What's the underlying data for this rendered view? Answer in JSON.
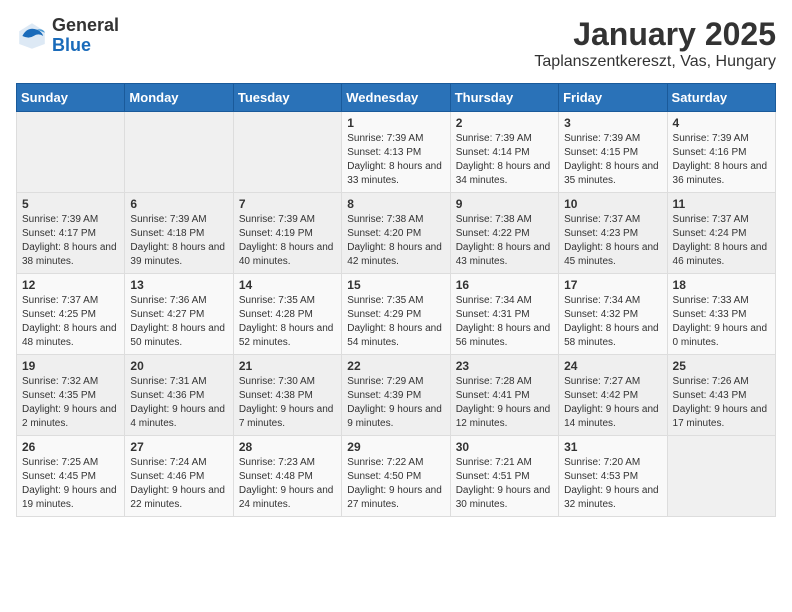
{
  "header": {
    "logo": {
      "general": "General",
      "blue": "Blue"
    },
    "title": "January 2025",
    "subtitle": "Taplanszentkereszt, Vas, Hungary"
  },
  "calendar": {
    "weekdays": [
      "Sunday",
      "Monday",
      "Tuesday",
      "Wednesday",
      "Thursday",
      "Friday",
      "Saturday"
    ],
    "weeks": [
      [
        {
          "day": "",
          "info": ""
        },
        {
          "day": "",
          "info": ""
        },
        {
          "day": "",
          "info": ""
        },
        {
          "day": "1",
          "info": "Sunrise: 7:39 AM\nSunset: 4:13 PM\nDaylight: 8 hours and 33 minutes."
        },
        {
          "day": "2",
          "info": "Sunrise: 7:39 AM\nSunset: 4:14 PM\nDaylight: 8 hours and 34 minutes."
        },
        {
          "day": "3",
          "info": "Sunrise: 7:39 AM\nSunset: 4:15 PM\nDaylight: 8 hours and 35 minutes."
        },
        {
          "day": "4",
          "info": "Sunrise: 7:39 AM\nSunset: 4:16 PM\nDaylight: 8 hours and 36 minutes."
        }
      ],
      [
        {
          "day": "5",
          "info": "Sunrise: 7:39 AM\nSunset: 4:17 PM\nDaylight: 8 hours and 38 minutes."
        },
        {
          "day": "6",
          "info": "Sunrise: 7:39 AM\nSunset: 4:18 PM\nDaylight: 8 hours and 39 minutes."
        },
        {
          "day": "7",
          "info": "Sunrise: 7:39 AM\nSunset: 4:19 PM\nDaylight: 8 hours and 40 minutes."
        },
        {
          "day": "8",
          "info": "Sunrise: 7:38 AM\nSunset: 4:20 PM\nDaylight: 8 hours and 42 minutes."
        },
        {
          "day": "9",
          "info": "Sunrise: 7:38 AM\nSunset: 4:22 PM\nDaylight: 8 hours and 43 minutes."
        },
        {
          "day": "10",
          "info": "Sunrise: 7:37 AM\nSunset: 4:23 PM\nDaylight: 8 hours and 45 minutes."
        },
        {
          "day": "11",
          "info": "Sunrise: 7:37 AM\nSunset: 4:24 PM\nDaylight: 8 hours and 46 minutes."
        }
      ],
      [
        {
          "day": "12",
          "info": "Sunrise: 7:37 AM\nSunset: 4:25 PM\nDaylight: 8 hours and 48 minutes."
        },
        {
          "day": "13",
          "info": "Sunrise: 7:36 AM\nSunset: 4:27 PM\nDaylight: 8 hours and 50 minutes."
        },
        {
          "day": "14",
          "info": "Sunrise: 7:35 AM\nSunset: 4:28 PM\nDaylight: 8 hours and 52 minutes."
        },
        {
          "day": "15",
          "info": "Sunrise: 7:35 AM\nSunset: 4:29 PM\nDaylight: 8 hours and 54 minutes."
        },
        {
          "day": "16",
          "info": "Sunrise: 7:34 AM\nSunset: 4:31 PM\nDaylight: 8 hours and 56 minutes."
        },
        {
          "day": "17",
          "info": "Sunrise: 7:34 AM\nSunset: 4:32 PM\nDaylight: 8 hours and 58 minutes."
        },
        {
          "day": "18",
          "info": "Sunrise: 7:33 AM\nSunset: 4:33 PM\nDaylight: 9 hours and 0 minutes."
        }
      ],
      [
        {
          "day": "19",
          "info": "Sunrise: 7:32 AM\nSunset: 4:35 PM\nDaylight: 9 hours and 2 minutes."
        },
        {
          "day": "20",
          "info": "Sunrise: 7:31 AM\nSunset: 4:36 PM\nDaylight: 9 hours and 4 minutes."
        },
        {
          "day": "21",
          "info": "Sunrise: 7:30 AM\nSunset: 4:38 PM\nDaylight: 9 hours and 7 minutes."
        },
        {
          "day": "22",
          "info": "Sunrise: 7:29 AM\nSunset: 4:39 PM\nDaylight: 9 hours and 9 minutes."
        },
        {
          "day": "23",
          "info": "Sunrise: 7:28 AM\nSunset: 4:41 PM\nDaylight: 9 hours and 12 minutes."
        },
        {
          "day": "24",
          "info": "Sunrise: 7:27 AM\nSunset: 4:42 PM\nDaylight: 9 hours and 14 minutes."
        },
        {
          "day": "25",
          "info": "Sunrise: 7:26 AM\nSunset: 4:43 PM\nDaylight: 9 hours and 17 minutes."
        }
      ],
      [
        {
          "day": "26",
          "info": "Sunrise: 7:25 AM\nSunset: 4:45 PM\nDaylight: 9 hours and 19 minutes."
        },
        {
          "day": "27",
          "info": "Sunrise: 7:24 AM\nSunset: 4:46 PM\nDaylight: 9 hours and 22 minutes."
        },
        {
          "day": "28",
          "info": "Sunrise: 7:23 AM\nSunset: 4:48 PM\nDaylight: 9 hours and 24 minutes."
        },
        {
          "day": "29",
          "info": "Sunrise: 7:22 AM\nSunset: 4:50 PM\nDaylight: 9 hours and 27 minutes."
        },
        {
          "day": "30",
          "info": "Sunrise: 7:21 AM\nSunset: 4:51 PM\nDaylight: 9 hours and 30 minutes."
        },
        {
          "day": "31",
          "info": "Sunrise: 7:20 AM\nSunset: 4:53 PM\nDaylight: 9 hours and 32 minutes."
        },
        {
          "day": "",
          "info": ""
        }
      ]
    ]
  }
}
